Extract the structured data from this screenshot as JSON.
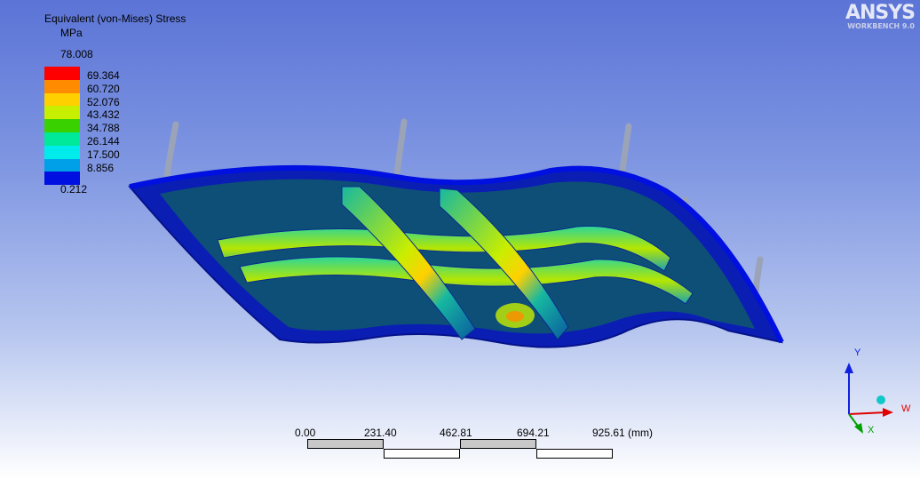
{
  "legend": {
    "title": "Equivalent (von-Mises) Stress",
    "unit": "MPa",
    "max": "78.008",
    "min": "0.212",
    "bands": [
      {
        "label": "69.364",
        "color": "#ff0000"
      },
      {
        "label": "60.720",
        "color": "#ff8c00"
      },
      {
        "label": "52.076",
        "color": "#ffd000"
      },
      {
        "label": "43.432",
        "color": "#c8ee00"
      },
      {
        "label": "34.788",
        "color": "#39d200"
      },
      {
        "label": "26.144",
        "color": "#00e89a"
      },
      {
        "label": "17.500",
        "color": "#00ecec"
      },
      {
        "label": "8.856",
        "color": "#00a0e8"
      },
      {
        "label": "",
        "color": "#0010e0"
      }
    ]
  },
  "logo": {
    "brand": "ANSYS",
    "subtitle": "WORKBENCH 9.0"
  },
  "scale": {
    "ticks": [
      "0.00",
      "231.40",
      "462.81",
      "694.21",
      "925.61 (mm)"
    ]
  },
  "triad": {
    "y_label": "Y",
    "w_label": "W",
    "x_label": "X"
  }
}
